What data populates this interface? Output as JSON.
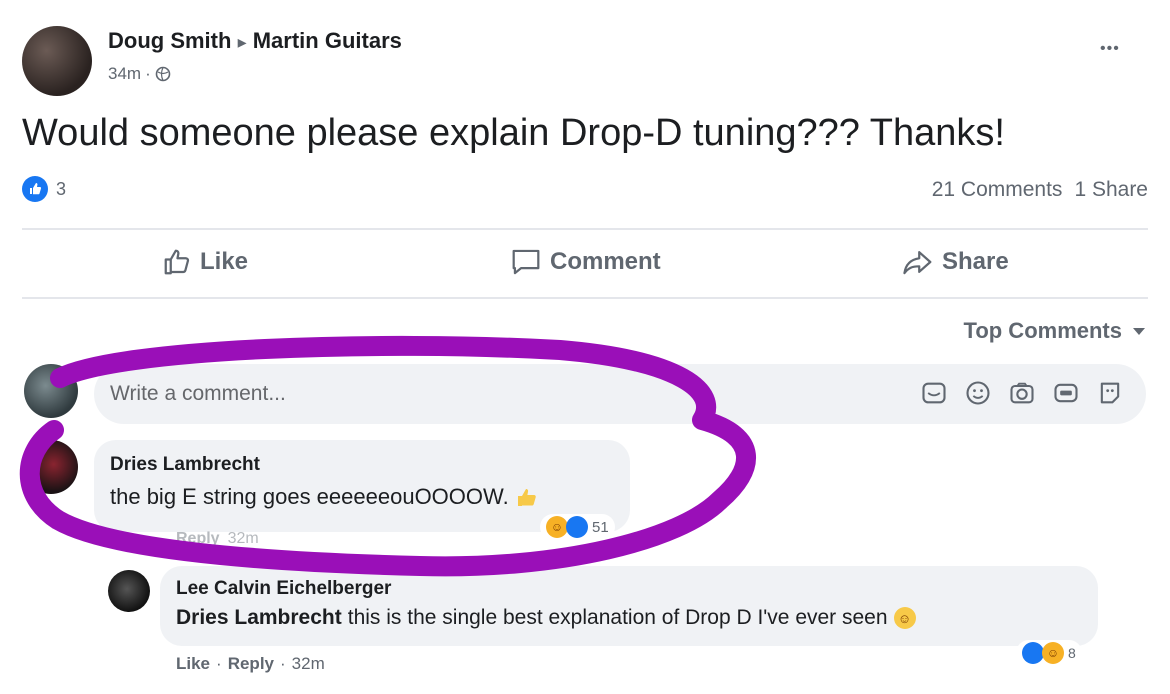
{
  "post": {
    "author": "Doug Smith",
    "arrow": "▸",
    "group": "Martin Guitars",
    "time": "34m",
    "dot": "·",
    "text": "Would someone please explain Drop-D tuning??? Thanks!",
    "reaction_count": "3",
    "comments_count": "21 Comments",
    "shares_count": "1 Share",
    "more": "•••"
  },
  "actions": {
    "like": "Like",
    "comment": "Comment",
    "share": "Share"
  },
  "sort": {
    "label": "Top Comments"
  },
  "composer": {
    "placeholder": "Write a comment..."
  },
  "comments": [
    {
      "author": "Dries Lambrecht",
      "text": "the big E string goes eeeeeeouOOOOW.",
      "reaction_count": "51",
      "reply": "Reply",
      "time": "32m"
    },
    {
      "author": "Lee Calvin Eichelberger",
      "mention": "Dries Lambrecht",
      "text": "this is the single best explanation of Drop D I've ever seen",
      "reaction_count": "8",
      "like": "Like",
      "dot": "·",
      "reply": "Reply",
      "time": "32m"
    }
  ],
  "colors": {
    "facebook_blue": "#1877f2",
    "link_blue": "#365899",
    "annotation_purple": "#9a0fb8",
    "muted_gray": "#606770",
    "bubble_gray": "#f0f2f5"
  },
  "icons": [
    "thumbs-up-icon",
    "comment-icon",
    "share-arrow-icon",
    "caret-down-icon",
    "sticker-icon",
    "emoji-icon",
    "camera-icon",
    "gif-icon",
    "avatar-sticker-icon",
    "globe-icon",
    "haha-icon",
    "like-reaction-icon"
  ]
}
